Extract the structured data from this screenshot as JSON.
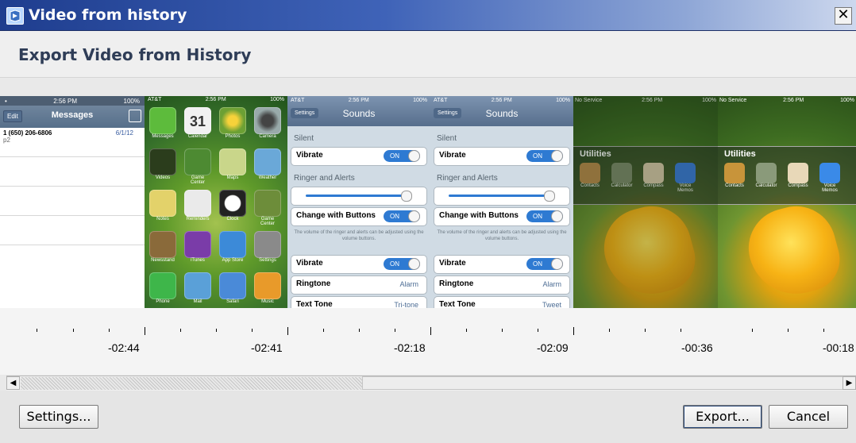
{
  "window": {
    "title": "Video from history",
    "close_glyph": "✕",
    "icon": "app-icon"
  },
  "header": {
    "heading": "Export Video from History"
  },
  "frames": {
    "messages": {
      "status_left": "•",
      "status_time": "2:56 PM",
      "status_right": "100%",
      "edit": "Edit",
      "title": "Messages",
      "row_number": "1 (650) 206-6806",
      "row_date": "6/1/12",
      "row_sub": "p2"
    },
    "home": {
      "status_carrier": "AT&T",
      "status_time": "2:56 PM",
      "status_battery": "100%",
      "calendar_day": "31",
      "labels": [
        "Messages",
        "Calendar",
        "Photos",
        "Camera",
        "Videos",
        "Game Center",
        "Maps",
        "Weather",
        "Notes",
        "Reminders",
        "Clock",
        "Game Center",
        "Newsstand",
        "iTunes",
        "App Store",
        "Settings",
        "Phone",
        "Mail",
        "Safari",
        "Music"
      ]
    },
    "sounds": {
      "status_carrier": "AT&T",
      "status_time": "2:56 PM",
      "status_battery": "100%",
      "back": "Settings",
      "title": "Sounds",
      "silent": "Silent",
      "vibrate": "Vibrate",
      "on": "ON",
      "ringer_alerts": "Ringer and Alerts",
      "change_buttons": "Change with Buttons",
      "note": "The volume of the ringer and alerts can be adjusted using the volume buttons.",
      "ringtone": "Ringtone",
      "ringtone_value": "Alarm",
      "text_tone": "Text Tone",
      "text_tone_value_a": "Tri-tone",
      "text_tone_value_b": "Tweet"
    },
    "utilities": {
      "status_carrier": "No Service",
      "status_time": "2:56 PM",
      "status_battery": "100%",
      "folder_title": "Utilities",
      "apps": [
        "Contacts",
        "Calculator",
        "Compass",
        "Voice Memos"
      ]
    }
  },
  "timeline": {
    "labels": [
      "-02:44",
      "-02:41",
      "-02:18",
      "-02:09",
      "-00:36",
      "-00:18"
    ]
  },
  "scrollbar": {
    "left_arrow": "◀",
    "right_arrow": "▶",
    "position": 0.43
  },
  "footer": {
    "settings_label": "Settings...",
    "export_label": "Export...",
    "cancel_label": "Cancel"
  },
  "colors": {
    "title_bar": "#1e3d8e",
    "toggle_on": "#2e7ad2"
  }
}
